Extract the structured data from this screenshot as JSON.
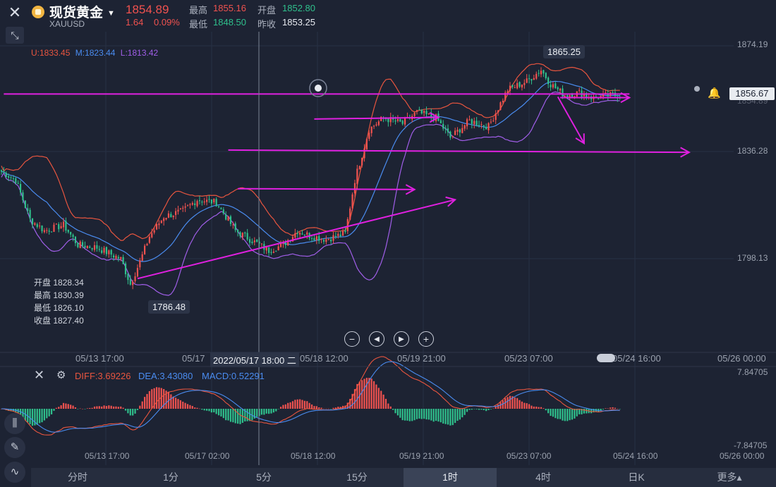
{
  "header": {
    "title": "现货黄金",
    "symbol": "XAUUSD",
    "price": "1854.89",
    "change": "1.64",
    "change_pct": "0.09%",
    "high_label": "最高",
    "high_value": "1855.16",
    "low_label": "最低",
    "low_value": "1848.50",
    "open_label": "开盘",
    "open_value": "1852.80",
    "prev_label": "昨收",
    "prev_value": "1853.25"
  },
  "bollinger": {
    "upper": "U:1833.45",
    "middle": "M:1823.44",
    "lower": "L:1813.42",
    "colors": {
      "upper": "#e8553f",
      "middle": "#4a8cf0",
      "lower": "#a05ee8"
    }
  },
  "ohlc_panel": [
    {
      "label": "开盘",
      "value": "1828.34"
    },
    {
      "label": "最高",
      "value": "1830.39"
    },
    {
      "label": "最低",
      "value": "1826.10"
    },
    {
      "label": "收盘",
      "value": "1827.40"
    }
  ],
  "annotations": {
    "peak": "1865.25",
    "trough": "1786.48",
    "current_price_tag": "1856.67",
    "hidden_tag": "1854.89"
  },
  "crosshair_time": "2022/05/17 18:00 二",
  "macd": {
    "diff": "DIFF:3.69226",
    "dea": "DEA:3.43080",
    "macd": "MACD:0.52291",
    "axis_top": "7.84705",
    "axis_bottom": "-7.84705",
    "colors": {
      "diff": "#e8553f",
      "dea": "#4a8cf0",
      "macd": "#c0c6d4"
    }
  },
  "colors": {
    "up": "#f0524f",
    "down": "#2fc08c",
    "trend_lines": "#e020e0",
    "background": "#1d2333"
  },
  "tabs": [
    {
      "label": "分时"
    },
    {
      "label": "1分"
    },
    {
      "label": "5分"
    },
    {
      "label": "15分"
    },
    {
      "label": "1时",
      "active": true
    },
    {
      "label": "4时"
    },
    {
      "label": "日K"
    },
    {
      "label": "更多▴"
    }
  ],
  "chart_data": {
    "type": "candlestick",
    "interval": "1时",
    "y_axis_ticks": [
      "1874.19",
      "1836.28",
      "1798.13"
    ],
    "x_axis_ticks": [
      "05/13 17:00",
      "05/17",
      "05/18 12:00",
      "05/19 21:00",
      "05/23 07:00",
      "05/24 16:00",
      "05/26 00:00"
    ],
    "macd_x_axis_ticks": [
      "05/13 17:00",
      "05/17 02:00",
      "05/18 12:00",
      "05/19 21:00",
      "05/23 07:00",
      "05/24 16:00",
      "05/26 00:00"
    ],
    "ylim": [
      1780,
      1880
    ],
    "close_anchors": [
      [
        0,
        1829
      ],
      [
        6,
        1826
      ],
      [
        12,
        1812
      ],
      [
        18,
        1808
      ],
      [
        26,
        1810
      ],
      [
        32,
        1803
      ],
      [
        40,
        1802
      ],
      [
        50,
        1798
      ],
      [
        54,
        1789
      ],
      [
        58,
        1797
      ],
      [
        62,
        1806
      ],
      [
        68,
        1813
      ],
      [
        76,
        1815
      ],
      [
        82,
        1819
      ],
      [
        90,
        1818
      ],
      [
        98,
        1808
      ],
      [
        106,
        1804
      ],
      [
        112,
        1801
      ],
      [
        118,
        1803
      ],
      [
        124,
        1808
      ],
      [
        130,
        1806
      ],
      [
        136,
        1805
      ],
      [
        140,
        1806
      ],
      [
        144,
        1807
      ],
      [
        148,
        1826
      ],
      [
        154,
        1844
      ],
      [
        160,
        1848
      ],
      [
        168,
        1846
      ],
      [
        174,
        1850
      ],
      [
        182,
        1848
      ],
      [
        188,
        1841
      ],
      [
        196,
        1847
      ],
      [
        204,
        1845
      ],
      [
        212,
        1858
      ],
      [
        220,
        1861
      ],
      [
        226,
        1865
      ],
      [
        230,
        1860
      ],
      [
        236,
        1856
      ],
      [
        242,
        1857
      ],
      [
        248,
        1855
      ],
      [
        254,
        1856
      ]
    ]
  },
  "trend_lines": [
    {
      "from": [
        1,
        1856.5
      ],
      "to": [
        263,
        1856.5
      ],
      "arrow": false
    },
    {
      "from": [
        234,
        1855.2
      ],
      "to": [
        263,
        1855.2
      ],
      "arrow": true
    },
    {
      "from": [
        233,
        1855.5
      ],
      "to": [
        244,
        1839
      ],
      "arrow": true
    },
    {
      "from": [
        95,
        1836.6
      ],
      "to": [
        288,
        1835.8
      ],
      "arrow": true
    },
    {
      "from": [
        131,
        1847.6
      ],
      "to": [
        183,
        1848.2
      ],
      "arrow": true
    },
    {
      "from": [
        99,
        1822.9
      ],
      "to": [
        173,
        1822.6
      ],
      "arrow": true
    },
    {
      "from": [
        57,
        1791
      ],
      "to": [
        190,
        1819
      ],
      "arrow": true
    }
  ],
  "price_tag_value": "1856.67"
}
